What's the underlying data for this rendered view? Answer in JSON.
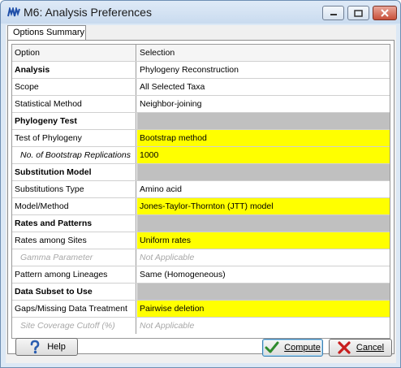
{
  "window": {
    "title": "M6: Analysis Preferences",
    "colors": {
      "highlight": "#ffff00",
      "section_fill": "#c0c0c0",
      "disabled_text": "#a8a8a8"
    }
  },
  "tabs": [
    {
      "label": "Options Summary",
      "active": true
    }
  ],
  "table": {
    "headers": {
      "option": "Option",
      "selection": "Selection"
    },
    "rows": [
      {
        "option": "Analysis",
        "selection": "Phylogeny Reconstruction",
        "style": "bold"
      },
      {
        "option": "Scope",
        "selection": "All Selected Taxa",
        "style": "normal"
      },
      {
        "option": "Statistical Method",
        "selection": "Neighbor-joining",
        "style": "normal"
      },
      {
        "option": "Phylogeny Test",
        "selection": "",
        "style": "section"
      },
      {
        "option": "Test of Phylogeny",
        "selection": "Bootstrap method",
        "style": "editable"
      },
      {
        "option": "No. of Bootstrap Replications",
        "selection": "1000",
        "style": "sub-editable"
      },
      {
        "option": "Substitution Model",
        "selection": "",
        "style": "section"
      },
      {
        "option": "Substitutions Type",
        "selection": "Amino acid",
        "style": "normal"
      },
      {
        "option": "Model/Method",
        "selection": "Jones-Taylor-Thornton (JTT) model",
        "style": "editable"
      },
      {
        "option": "Rates and Patterns",
        "selection": "",
        "style": "section"
      },
      {
        "option": "Rates among Sites",
        "selection": "Uniform rates",
        "style": "editable"
      },
      {
        "option": "Gamma Parameter",
        "selection": "Not Applicable",
        "style": "disabled"
      },
      {
        "option": "Pattern among Lineages",
        "selection": "Same (Homogeneous)",
        "style": "normal"
      },
      {
        "option": "Data Subset to Use",
        "selection": "",
        "style": "section"
      },
      {
        "option": "Gaps/Missing Data Treatment",
        "selection": "Pairwise deletion",
        "style": "editable"
      },
      {
        "option": "Site Coverage Cutoff (%)",
        "selection": "Not Applicable",
        "style": "disabled"
      }
    ]
  },
  "buttons": {
    "help": {
      "label": "Help",
      "icon": "help-icon"
    },
    "compute": {
      "label": "Compute",
      "icon": "checkmark-icon"
    },
    "cancel": {
      "label": "Cancel",
      "icon": "cancel-x-icon"
    }
  }
}
